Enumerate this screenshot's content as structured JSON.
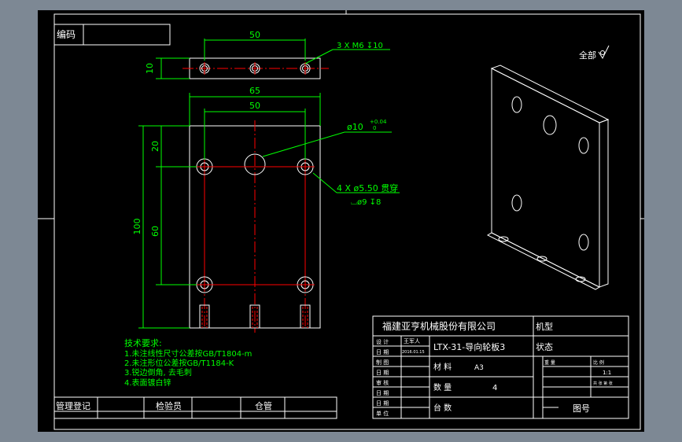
{
  "title_block": {
    "top_left_label": "编码",
    "company": "福建亚亨机械股份有限公司",
    "drawing_title": "LTX-31-导向轮板3",
    "material_label": "材 料",
    "material_value": "A3",
    "quantity_label": "数 量",
    "quantity_value": "4",
    "units_label": "台 数",
    "drawing_no_label": "图号",
    "design_label": "设 计",
    "designer": "王军人",
    "design_date": "2016.01.15",
    "date_label": "日 期",
    "draw_label": "制 图",
    "check_label": "审 核",
    "approve_label": "单 位",
    "model_label": "机型",
    "status_label": "状态",
    "weight_label": "重 量",
    "scale_label": "比 例",
    "scale_value": "1:1",
    "sheet_label": "共 张 第 张",
    "bottom_labels": [
      "管理登记",
      "检验员",
      "仓管"
    ]
  },
  "surface": {
    "label": "全部",
    "symbol": "surface-finish-icon"
  },
  "dimensions": {
    "top_width": "50",
    "top_thickness": "10",
    "thread_note": "3 X M6 ↧10",
    "overall_width": "65",
    "hole_spacing": "50",
    "center_hole": "ø10",
    "tol_plus": "+0.04",
    "tol_minus": "0",
    "counterbore_note": "4 X ø5.50 贯穿",
    "counterbore_sub": "⌴ø9 ↧8",
    "dim_20": "20",
    "dim_60": "60",
    "dim_100": "100"
  },
  "notes": {
    "heading": "技术要求:",
    "items": [
      "1.未注线性尺寸公差按GB/T1804-m",
      "2.未注形位公差按GB/T1184-K",
      "3.锐边倒角, 去毛刺",
      "4.表面镀白锌"
    ]
  },
  "colors": {
    "background": "#7d8894",
    "sheet": "#000000",
    "line": "#ffffff",
    "dimension": "#00ff00",
    "centerline": "#ff0000"
  }
}
